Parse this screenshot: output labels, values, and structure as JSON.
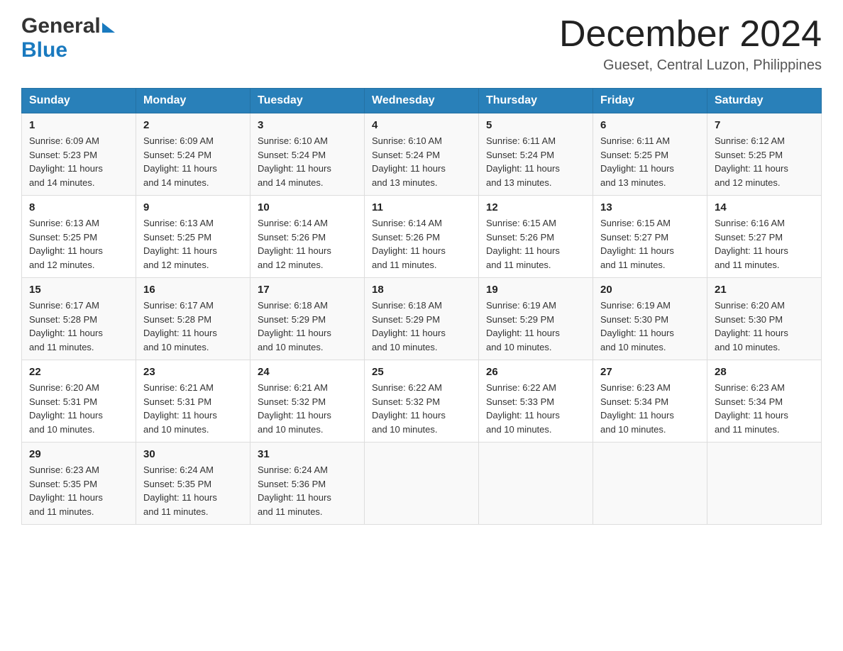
{
  "header": {
    "logo_general": "General",
    "logo_blue": "Blue",
    "month_title": "December 2024",
    "location": "Gueset, Central Luzon, Philippines"
  },
  "days_of_week": [
    "Sunday",
    "Monday",
    "Tuesday",
    "Wednesday",
    "Thursday",
    "Friday",
    "Saturday"
  ],
  "weeks": [
    [
      {
        "day": "1",
        "sunrise": "6:09 AM",
        "sunset": "5:23 PM",
        "daylight": "11 hours and 14 minutes."
      },
      {
        "day": "2",
        "sunrise": "6:09 AM",
        "sunset": "5:24 PM",
        "daylight": "11 hours and 14 minutes."
      },
      {
        "day": "3",
        "sunrise": "6:10 AM",
        "sunset": "5:24 PM",
        "daylight": "11 hours and 14 minutes."
      },
      {
        "day": "4",
        "sunrise": "6:10 AM",
        "sunset": "5:24 PM",
        "daylight": "11 hours and 13 minutes."
      },
      {
        "day": "5",
        "sunrise": "6:11 AM",
        "sunset": "5:24 PM",
        "daylight": "11 hours and 13 minutes."
      },
      {
        "day": "6",
        "sunrise": "6:11 AM",
        "sunset": "5:25 PM",
        "daylight": "11 hours and 13 minutes."
      },
      {
        "day": "7",
        "sunrise": "6:12 AM",
        "sunset": "5:25 PM",
        "daylight": "11 hours and 12 minutes."
      }
    ],
    [
      {
        "day": "8",
        "sunrise": "6:13 AM",
        "sunset": "5:25 PM",
        "daylight": "11 hours and 12 minutes."
      },
      {
        "day": "9",
        "sunrise": "6:13 AM",
        "sunset": "5:25 PM",
        "daylight": "11 hours and 12 minutes."
      },
      {
        "day": "10",
        "sunrise": "6:14 AM",
        "sunset": "5:26 PM",
        "daylight": "11 hours and 12 minutes."
      },
      {
        "day": "11",
        "sunrise": "6:14 AM",
        "sunset": "5:26 PM",
        "daylight": "11 hours and 11 minutes."
      },
      {
        "day": "12",
        "sunrise": "6:15 AM",
        "sunset": "5:26 PM",
        "daylight": "11 hours and 11 minutes."
      },
      {
        "day": "13",
        "sunrise": "6:15 AM",
        "sunset": "5:27 PM",
        "daylight": "11 hours and 11 minutes."
      },
      {
        "day": "14",
        "sunrise": "6:16 AM",
        "sunset": "5:27 PM",
        "daylight": "11 hours and 11 minutes."
      }
    ],
    [
      {
        "day": "15",
        "sunrise": "6:17 AM",
        "sunset": "5:28 PM",
        "daylight": "11 hours and 11 minutes."
      },
      {
        "day": "16",
        "sunrise": "6:17 AM",
        "sunset": "5:28 PM",
        "daylight": "11 hours and 10 minutes."
      },
      {
        "day": "17",
        "sunrise": "6:18 AM",
        "sunset": "5:29 PM",
        "daylight": "11 hours and 10 minutes."
      },
      {
        "day": "18",
        "sunrise": "6:18 AM",
        "sunset": "5:29 PM",
        "daylight": "11 hours and 10 minutes."
      },
      {
        "day": "19",
        "sunrise": "6:19 AM",
        "sunset": "5:29 PM",
        "daylight": "11 hours and 10 minutes."
      },
      {
        "day": "20",
        "sunrise": "6:19 AM",
        "sunset": "5:30 PM",
        "daylight": "11 hours and 10 minutes."
      },
      {
        "day": "21",
        "sunrise": "6:20 AM",
        "sunset": "5:30 PM",
        "daylight": "11 hours and 10 minutes."
      }
    ],
    [
      {
        "day": "22",
        "sunrise": "6:20 AM",
        "sunset": "5:31 PM",
        "daylight": "11 hours and 10 minutes."
      },
      {
        "day": "23",
        "sunrise": "6:21 AM",
        "sunset": "5:31 PM",
        "daylight": "11 hours and 10 minutes."
      },
      {
        "day": "24",
        "sunrise": "6:21 AM",
        "sunset": "5:32 PM",
        "daylight": "11 hours and 10 minutes."
      },
      {
        "day": "25",
        "sunrise": "6:22 AM",
        "sunset": "5:32 PM",
        "daylight": "11 hours and 10 minutes."
      },
      {
        "day": "26",
        "sunrise": "6:22 AM",
        "sunset": "5:33 PM",
        "daylight": "11 hours and 10 minutes."
      },
      {
        "day": "27",
        "sunrise": "6:23 AM",
        "sunset": "5:34 PM",
        "daylight": "11 hours and 10 minutes."
      },
      {
        "day": "28",
        "sunrise": "6:23 AM",
        "sunset": "5:34 PM",
        "daylight": "11 hours and 11 minutes."
      }
    ],
    [
      {
        "day": "29",
        "sunrise": "6:23 AM",
        "sunset": "5:35 PM",
        "daylight": "11 hours and 11 minutes."
      },
      {
        "day": "30",
        "sunrise": "6:24 AM",
        "sunset": "5:35 PM",
        "daylight": "11 hours and 11 minutes."
      },
      {
        "day": "31",
        "sunrise": "6:24 AM",
        "sunset": "5:36 PM",
        "daylight": "11 hours and 11 minutes."
      },
      null,
      null,
      null,
      null
    ]
  ],
  "labels": {
    "sunrise": "Sunrise:",
    "sunset": "Sunset:",
    "daylight": "Daylight:"
  }
}
